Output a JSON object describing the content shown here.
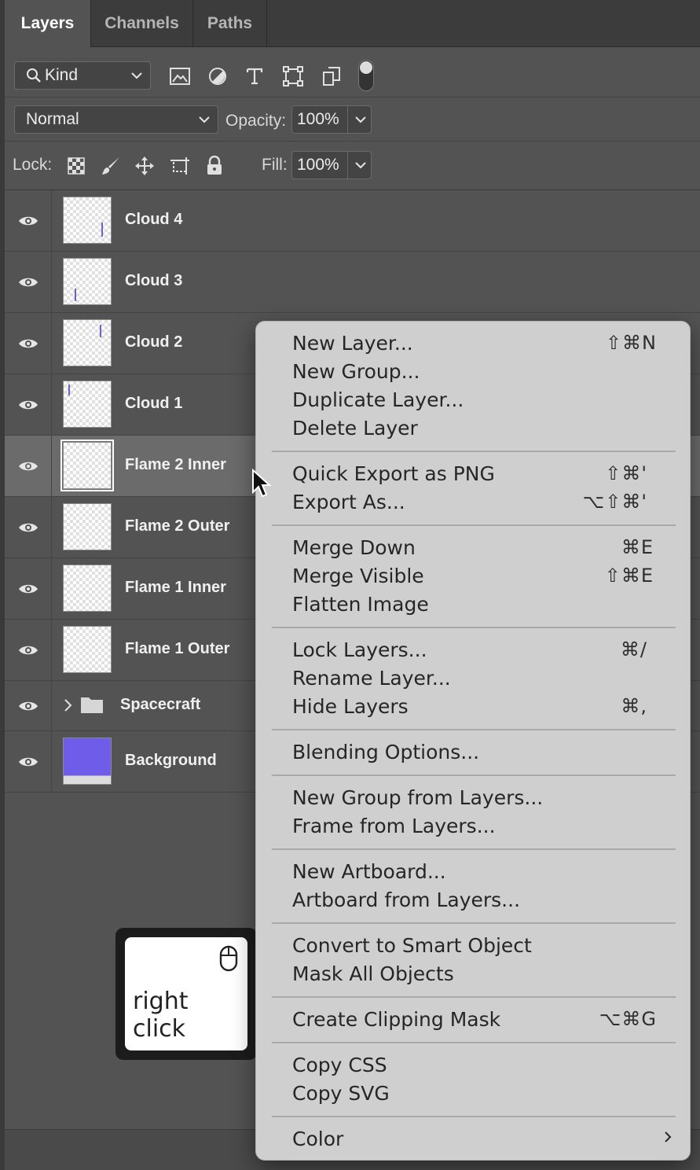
{
  "tabs": [
    "Layers",
    "Channels",
    "Paths"
  ],
  "filter": {
    "kind_label": "Kind"
  },
  "blend": {
    "mode": "Normal",
    "opacity_label": "Opacity:",
    "opacity_value": "100%"
  },
  "lock": {
    "label": "Lock:",
    "fill_label": "Fill:",
    "fill_value": "100%"
  },
  "layers": [
    {
      "name": "Cloud 4"
    },
    {
      "name": "Cloud 3"
    },
    {
      "name": "Cloud 2"
    },
    {
      "name": "Cloud 1"
    },
    {
      "name": "Flame 2 Inner"
    },
    {
      "name": "Flame 2 Outer"
    },
    {
      "name": "Flame 1 Inner"
    },
    {
      "name": "Flame 1 Outer"
    },
    {
      "name": "Spacecraft"
    },
    {
      "name": "Background"
    }
  ],
  "menu": {
    "items": [
      {
        "label": "New Layer...",
        "shortcut": "⇧⌘N"
      },
      {
        "label": "New Group...",
        "shortcut": ""
      },
      {
        "label": "Duplicate Layer...",
        "shortcut": ""
      },
      {
        "label": "Delete Layer",
        "shortcut": ""
      },
      {
        "label": "Quick Export as PNG",
        "shortcut": "⇧⌘'"
      },
      {
        "label": "Export As...",
        "shortcut": "⌥⇧⌘'"
      },
      {
        "label": "Merge Down",
        "shortcut": "⌘E"
      },
      {
        "label": "Merge Visible",
        "shortcut": "⇧⌘E"
      },
      {
        "label": "Flatten Image",
        "shortcut": ""
      },
      {
        "label": "Lock Layers...",
        "shortcut": "⌘/"
      },
      {
        "label": "Rename Layer...",
        "shortcut": ""
      },
      {
        "label": "Hide Layers",
        "shortcut": "⌘,"
      },
      {
        "label": "Blending Options...",
        "shortcut": ""
      },
      {
        "label": "New Group from Layers...",
        "shortcut": ""
      },
      {
        "label": "Frame from Layers...",
        "shortcut": ""
      },
      {
        "label": "New Artboard...",
        "shortcut": ""
      },
      {
        "label": "Artboard from Layers...",
        "shortcut": ""
      },
      {
        "label": "Convert to Smart Object",
        "shortcut": ""
      },
      {
        "label": "Mask All Objects",
        "shortcut": ""
      },
      {
        "label": "Create Clipping Mask",
        "shortcut": "⌥⌘G"
      },
      {
        "label": "Copy CSS",
        "shortcut": ""
      },
      {
        "label": "Copy SVG",
        "shortcut": ""
      },
      {
        "label": "Color",
        "shortcut": ""
      }
    ]
  },
  "badge": {
    "text": "right click"
  },
  "colors": {
    "panel": "#535353",
    "selected_row": "#6b6b6b",
    "menu_bg": "#cfcfcf",
    "background_layer": "#6f5ce8"
  },
  "icons": {
    "filter": [
      "image-filter-icon",
      "adjustment-filter-icon",
      "type-filter-icon",
      "shape-filter-icon",
      "smart-object-filter-icon"
    ],
    "lock": [
      "lock-transparent-icon",
      "lock-paint-icon",
      "lock-position-icon",
      "lock-artboard-icon",
      "lock-all-icon"
    ]
  }
}
